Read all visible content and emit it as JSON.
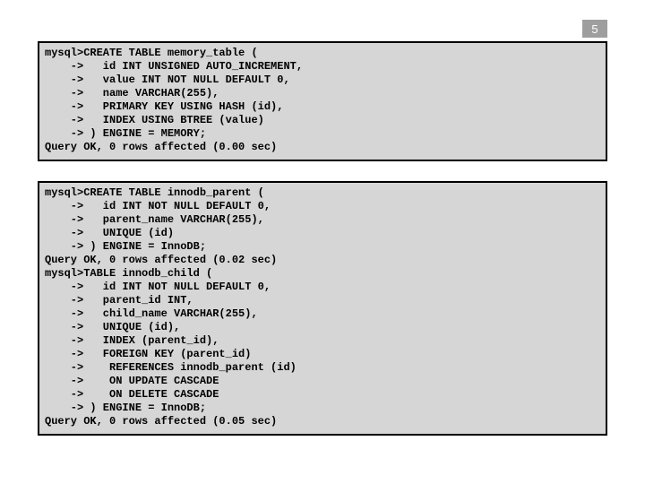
{
  "page_number": "5",
  "blocks": {
    "top": "mysql>CREATE TABLE memory_table (\n    ->   id INT UNSIGNED AUTO_INCREMENT,\n    ->   value INT NOT NULL DEFAULT 0,\n    ->   name VARCHAR(255),\n    ->   PRIMARY KEY USING HASH (id),\n    ->   INDEX USING BTREE (value)\n    -> ) ENGINE = MEMORY;\nQuery OK, 0 rows affected (0.00 sec)",
    "bottom": "mysql>CREATE TABLE innodb_parent (\n    ->   id INT NOT NULL DEFAULT 0,\n    ->   parent_name VARCHAR(255),\n    ->   UNIQUE (id)\n    -> ) ENGINE = InnoDB;\nQuery OK, 0 rows affected (0.02 sec)\nmysql>TABLE innodb_child (\n    ->   id INT NOT NULL DEFAULT 0,\n    ->   parent_id INT,\n    ->   child_name VARCHAR(255),\n    ->   UNIQUE (id),\n    ->   INDEX (parent_id),\n    ->   FOREIGN KEY (parent_id)\n    ->    REFERENCES innodb_parent (id)\n    ->    ON UPDATE CASCADE\n    ->    ON DELETE CASCADE\n    -> ) ENGINE = InnoDB;\nQuery OK, 0 rows affected (0.05 sec)"
  }
}
